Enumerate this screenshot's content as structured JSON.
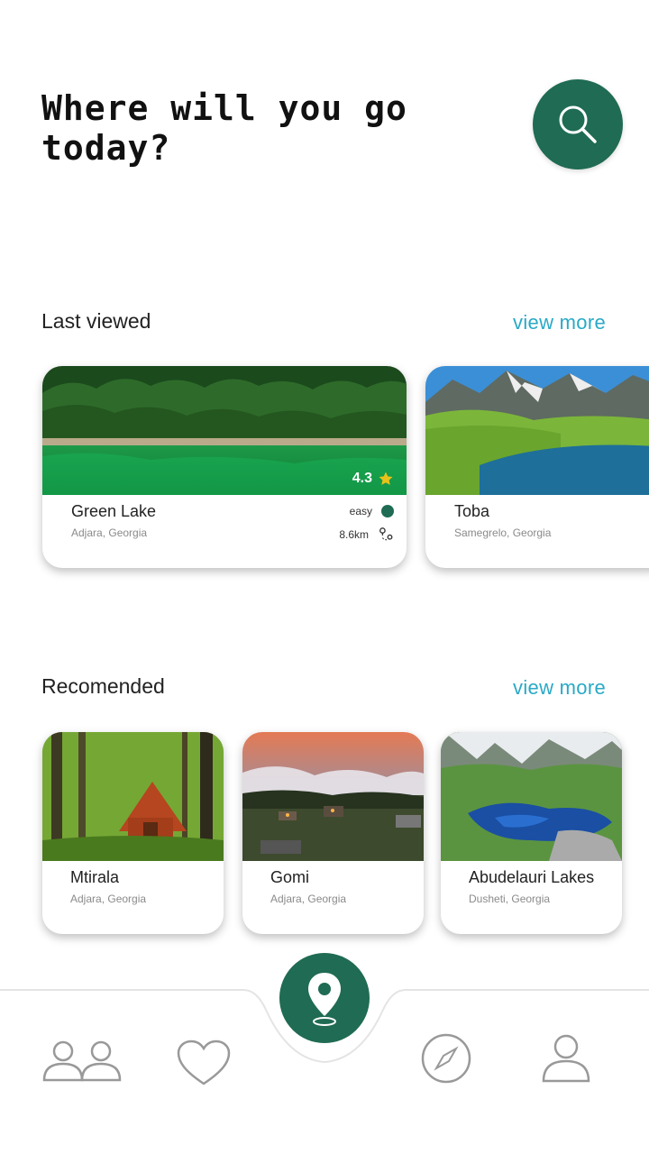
{
  "header": {
    "title": "Where will you go today?"
  },
  "last_viewed": {
    "title": "Last viewed",
    "view_more": "view more",
    "cards": [
      {
        "name": "Green Lake",
        "location": "Adjara, Georgia",
        "rating": "4.3",
        "difficulty": "easy",
        "distance": "8.6km"
      },
      {
        "name": "Toba",
        "location": "Samegrelo, Georgia"
      }
    ]
  },
  "recommended": {
    "title": "Recomended",
    "view_more": "view more",
    "cards": [
      {
        "name": "Mtirala",
        "location": "Adjara, Georgia"
      },
      {
        "name": "Gomi",
        "location": "Adjara, Georgia"
      },
      {
        "name": "Abudelauri Lakes",
        "location": "Dusheti, Georgia"
      }
    ]
  },
  "icons": {
    "search": "search-icon",
    "star": "star-icon",
    "route": "route-icon",
    "map_pin": "map-pin-icon",
    "friends": "friends-icon",
    "favorites": "heart-icon",
    "explore": "compass-icon",
    "profile": "profile-icon"
  },
  "colors": {
    "primary": "#1f6b53",
    "accent": "#29a9c6",
    "star": "#e8c21a"
  }
}
